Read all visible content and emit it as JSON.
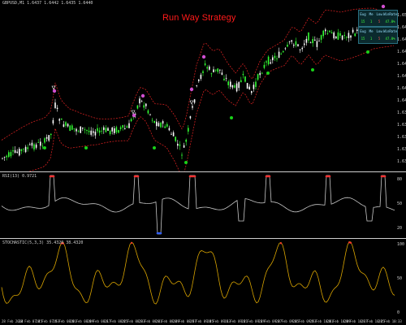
{
  "chart": {
    "symbol_header": "GBPUSD,M1 1.6437 1.6442 1.6435 1.6440",
    "title": "Run Way Strategy",
    "price_axis": [
      "1.6505",
      "1.6490",
      "1.6475",
      "1.6460",
      "1.6445",
      "1.6430",
      "1.6415",
      "1.6400",
      "1.6385",
      "1.6370",
      "1.6355",
      "1.6340",
      "1.6325"
    ],
    "colors": {
      "title": "#ff1a1a",
      "bull": "#33ff33",
      "bear": "#ffffff",
      "band": "#cc1f1f",
      "rsi": "#c8c8c8",
      "stoch": "#d9a400",
      "arrow_buy": "#19d119",
      "arrow_sell": "#d14fd1"
    }
  },
  "stats_boxes": [
    {
      "headers": [
        "Eug",
        "Me",
        "Low",
        "WinRate"
      ],
      "values": [
        "15",
        "1",
        "5",
        "47.0%"
      ]
    },
    {
      "headers": [
        "Eug",
        "Me",
        "Low",
        "WinRate"
      ],
      "values": [
        "15",
        "1",
        "5",
        "47.0%"
      ]
    }
  ],
  "rsi": {
    "label": "RSI(13) 0.9721",
    "axis": [
      "80",
      "50",
      "20"
    ]
  },
  "stoch": {
    "label": "STOCHASTIC(5,3,3) 35.4320 38.4320",
    "axis": [
      "100",
      "50",
      "0"
    ]
  },
  "time_axis": [
    "28 Feb 2014",
    "28 Feb 07:45",
    "28 Feb 07:53",
    "28 Feb 08:01",
    "28 Feb 08:09",
    "28 Feb 08:17",
    "28 Feb 08:25",
    "28 Feb 08:33",
    "28 Feb 08:41",
    "28 Feb 08:49",
    "28 Feb 08:57",
    "28 Feb 09:05",
    "28 Feb 09:13",
    "28 Feb 09:21",
    "28 Feb 09:29",
    "28 Feb 09:37",
    "28 Feb 09:45",
    "28 Feb 09:53",
    "28 Feb 10:01",
    "28 Feb 10:09",
    "28 Feb 10:17",
    "28 Feb 10:25",
    "28 Feb 10:33"
  ]
}
